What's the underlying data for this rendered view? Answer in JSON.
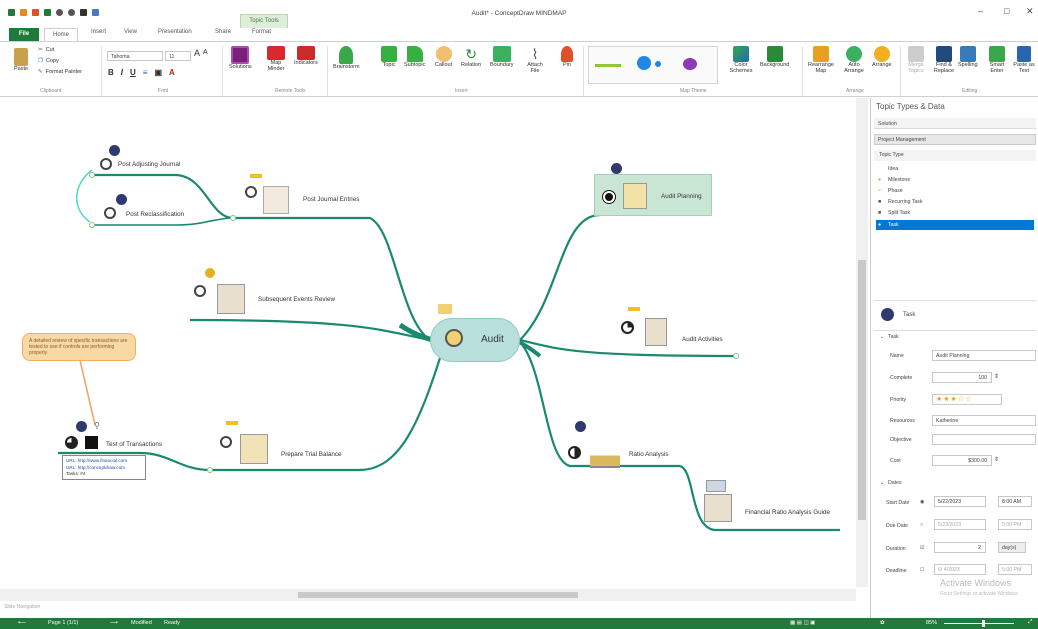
{
  "window": {
    "title": "Audit* - ConceptDraw MINDMAP",
    "context_tab": "Topic Tools"
  },
  "tabs": [
    "File",
    "Home",
    "Insert",
    "View",
    "Presentation",
    "Share",
    "Format"
  ],
  "ribbon": {
    "clipboard": {
      "paste": "Paste",
      "cut": "Cut",
      "copy": "Copy",
      "format_painter": "Format Painter",
      "group": "Clipboard"
    },
    "font": {
      "family": "Tahoma",
      "size": "11",
      "group": "Font"
    },
    "remote_tools": {
      "solutions": "Solutions",
      "map_minder": "Map Minder",
      "indicators": "Indicators",
      "group": "Remote Tools"
    },
    "insert": {
      "brainstorm": "Brainstorm",
      "topic": "Topic",
      "subtopic": "Subtopic",
      "callout": "Callout",
      "relation": "Relation",
      "boundary": "Boundary",
      "attach_file": "Attach File",
      "pin": "Pin",
      "group": "Insert"
    },
    "map_theme": {
      "group": "Map Theme",
      "color_schemes": "Color Schemes",
      "background": "Background"
    },
    "arrange": {
      "rearrange_map": "Rearrange Map",
      "auto_arrange": "Auto Arrange",
      "arrange": "Arrange",
      "group": "Arrange"
    },
    "editing": {
      "merge_topics": "Merge Topics",
      "find_replace": "Find & Replace",
      "spelling": "Spelling",
      "smart_enter": "Smart Enter",
      "paste_as_text": "Paste as Text",
      "group": "Editing"
    }
  },
  "map": {
    "central": "Audit",
    "topics": {
      "post_journal_entries": "Post Journal Entries",
      "post_adjusting_journal": "Post Adjusting Journal",
      "post_reclassification": "Post Reclassification",
      "subsequent_events": "Subsequent Events Review",
      "prepare_trial_balance": "Prepare Trial Balance",
      "test_of_transactions": "Test of Transactions",
      "audit_planning": "Audit Planning",
      "audit_activities": "Audit Activities",
      "ratio_analysis": "Ratio Analysis",
      "financial_ratio_guide": "Financial Ratio Analysis Guide"
    },
    "callout": "A detailed review of specific transactions are tested to see if controls are performing properly",
    "links_box": {
      "url1": "URL: http://www.financial.com",
      "url2": "URL: http://conceptdraw.com",
      "tasks": "Tasks: #4"
    }
  },
  "panel": {
    "title": "Topic Types & Data",
    "solution_label": "Solution",
    "solution_value": "Project Management",
    "topic_type_label": "Topic Type",
    "topic_types": [
      "Idea",
      "Milestone",
      "Phase",
      "Recurring Task",
      "Split Task",
      "Task"
    ],
    "selected_type": "Task",
    "task_header": "Task",
    "task_section": "Task",
    "fields": {
      "name_label": "Name",
      "name": "Audit Planning",
      "complete_label": "Complete",
      "complete": "100",
      "priority_label": "Priority",
      "resources_label": "Resources",
      "resources": "Katherine",
      "objective_label": "Objective",
      "objective": "",
      "cost_label": "Cost",
      "cost": "$300.00"
    },
    "dates_section": "Dates",
    "dates": {
      "start_label": "Start Date",
      "start": "5/22/2023",
      "start_time": "8:00 AM",
      "due_label": "Due Date",
      "due": "5/23/2023",
      "due_time": "5:00 PM",
      "duration_label": "Duration",
      "duration": "2",
      "duration_unit": "day(s)",
      "deadline_label": "Deadline",
      "deadline": "6/ 4/2023",
      "deadline_time": "5:00 PM"
    },
    "watermark1": "Activate Windows",
    "watermark2": "Go to Settings to activate Windows."
  },
  "status": {
    "page": "Page 1 (1/1)",
    "modified": "Modified",
    "ready": "Ready",
    "zoom": "85%",
    "navigation": "Slide Navigation"
  },
  "colors": {
    "branch": "#1a8a6e",
    "accent": "#1f7a3b",
    "central_fill": "#b9e0dc",
    "selected": "#0078d7"
  }
}
